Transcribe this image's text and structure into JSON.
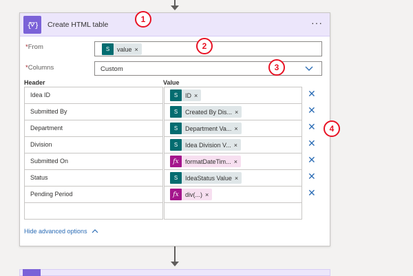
{
  "action": {
    "title": "Create HTML table",
    "more_label": "···",
    "icon_name": "table-variable-icon",
    "accent": "#7b62d8",
    "header_bg": "#ece6fb"
  },
  "from_field": {
    "required_mark": "*",
    "label": "From",
    "token": {
      "text": "value",
      "source": "sharepoint"
    }
  },
  "columns_field": {
    "required_mark": "*",
    "label": "Columns",
    "value": "Custom"
  },
  "grid": {
    "header_label": "Header",
    "value_label": "Value",
    "rows": [
      {
        "header": "Idea ID",
        "token": "ID",
        "kind": "sp"
      },
      {
        "header": "Submitted By",
        "token": "Created By Dis...",
        "kind": "sp"
      },
      {
        "header": "Department",
        "token": "Department Va...",
        "kind": "sp"
      },
      {
        "header": "Division",
        "token": "Idea Division V...",
        "kind": "sp"
      },
      {
        "header": "Submitted On",
        "token": "formatDateTim...",
        "kind": "fx"
      },
      {
        "header": "Status",
        "token": "IdeaStatus Value",
        "kind": "sp"
      },
      {
        "header": "Pending Period",
        "token": "div(...)",
        "kind": "fx"
      },
      {
        "header": "",
        "token": "",
        "kind": "empty"
      }
    ]
  },
  "advanced_label": "Hide advanced options",
  "callouts": [
    "1",
    "2",
    "3",
    "4"
  ],
  "token_remove": "×",
  "row_remove": "✕",
  "fx_symbol": "fx",
  "sp_symbol": "S"
}
